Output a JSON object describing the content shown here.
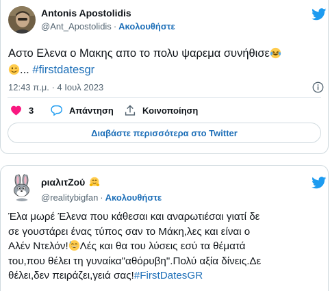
{
  "tweets": [
    {
      "display_name": "Antonis Apostolidis",
      "handle": "@Ant_Apostolidis",
      "separator": "·",
      "follow_label": "Ακολουθήστε",
      "text_line1": "Αστο Ελενα ο Μακης απο το πολυ ψαρεμα συνήθισε",
      "text_line2_ellipsis": "...",
      "hashtag": "#firstdatesgr",
      "emojis": [
        "laughing-tears-emoji",
        "winking-face-emoji"
      ],
      "timestamp": "12:43 π.μ. · 4 Ιουλ 2023",
      "likes_count": "3",
      "reply_label": "Απάντηση",
      "share_label": "Κοινοποίηση",
      "read_more_label": "Διαβάστε περισσότερα στο Twitter"
    },
    {
      "display_name": "ριαλιτΖού",
      "handle": "@realitybigfan",
      "separator": "·",
      "follow_label": "Ακολουθήστε",
      "text_line1": "Έλα μωρέ Έλενα που κάθεσαι και αναρωτιέσαι γιατί δε",
      "text_line2": "σε γουστάρει ένας τύπος σαν το Μάκη,λες και είναι ο",
      "text_line3_a": "Αλέν Ντελόν!",
      "text_line3_b": "Λές και θα του λύσεις εσύ τα θέματά",
      "text_line4": "του,που θέλει τη γυναίκα\"αθόρυβη\".Πολύ αξία δίνεις.Δε",
      "text_line5": "θέλει,δεν πειράζει,γειά σας!",
      "hashtag": "#FirstDatesGR",
      "emojis": [
        "hugging-face-emoji",
        "grinning-sweat-emoji"
      ]
    }
  ],
  "colors": {
    "link": "#1d6fb8",
    "twitter_blue": "#1d9bf0",
    "heart": "#f91880",
    "text": "#0f1419",
    "muted": "#536471"
  }
}
